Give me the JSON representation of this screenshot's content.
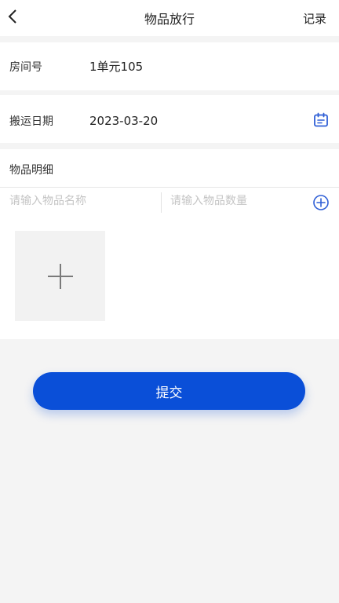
{
  "header": {
    "title": "物品放行",
    "record_label": "记录"
  },
  "form": {
    "room": {
      "label": "房间号",
      "value": "1单元105"
    },
    "date": {
      "label": "搬运日期",
      "value": "2023-03-20"
    },
    "items": {
      "title": "物品明细",
      "name_placeholder": "请输入物品名称",
      "quantity_placeholder": "请输入物品数量"
    }
  },
  "submit_label": "提交",
  "colors": {
    "primary": "#0a4fd8",
    "background": "#f4f4f4",
    "placeholder": "#c4c4c4",
    "icon_blue": "#2f5fd6"
  },
  "icons": {
    "back": "chevron-left-icon",
    "calendar": "calendar-icon",
    "add": "plus-circle-icon",
    "upload": "plus-icon"
  }
}
